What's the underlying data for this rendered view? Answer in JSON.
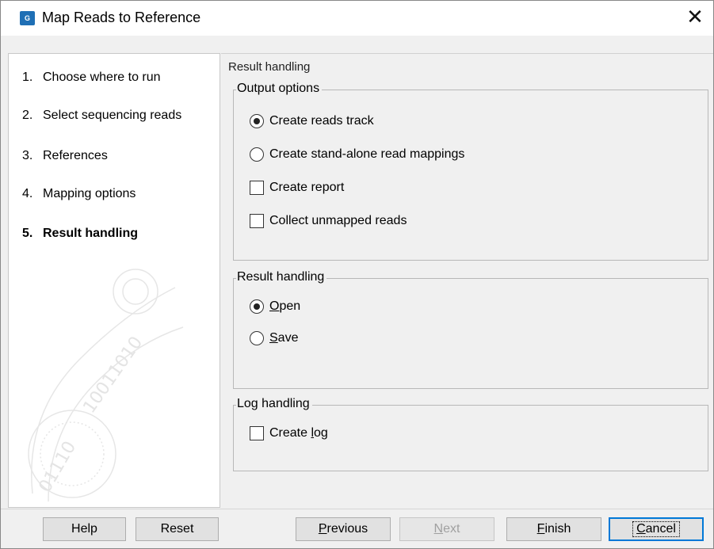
{
  "window": {
    "title": "Map Reads to Reference",
    "app_icon_text": "G",
    "close_symbol": "✕"
  },
  "sidebar": {
    "steps": [
      {
        "num": "1.",
        "label": "Choose where to run"
      },
      {
        "num": "2.",
        "label": "Select sequencing reads"
      },
      {
        "num": "3.",
        "label": "References"
      },
      {
        "num": "4.",
        "label": "Mapping options"
      },
      {
        "num": "5.",
        "label": "Result handling"
      }
    ],
    "active_step": 5
  },
  "content": {
    "section_title": "Result handling",
    "output_options": {
      "legend": "Output options",
      "create_reads_track": {
        "label": "Create reads track",
        "checked": true
      },
      "create_standalone": {
        "label": "Create stand-alone read mappings",
        "checked": false
      },
      "create_report": {
        "label": "Create report",
        "checked": false
      },
      "collect_unmapped": {
        "label": "Collect unmapped reads",
        "checked": false
      }
    },
    "result_handling": {
      "legend": "Result handling",
      "open": {
        "label_mnemonic": "O",
        "label_rest": "pen",
        "checked": true
      },
      "save": {
        "label_mnemonic": "S",
        "label_rest": "ave",
        "checked": false
      }
    },
    "log_handling": {
      "legend": "Log handling",
      "create_log": {
        "label_prefix": "Create ",
        "label_mnemonic": "l",
        "label_rest": "og",
        "checked": false
      }
    }
  },
  "footer": {
    "help": "Help",
    "reset": "Reset",
    "previous": {
      "mnemonic": "P",
      "rest": "revious"
    },
    "next": {
      "mnemonic": "N",
      "rest": "ext",
      "disabled": true
    },
    "finish": {
      "mnemonic": "F",
      "rest": "inish"
    },
    "cancel": {
      "mnemonic": "C",
      "rest": "ancel"
    }
  },
  "colors": {
    "accent": "#0078d7",
    "app_icon": "#1f6fb5",
    "panel_bg": "#f0f0f0"
  }
}
